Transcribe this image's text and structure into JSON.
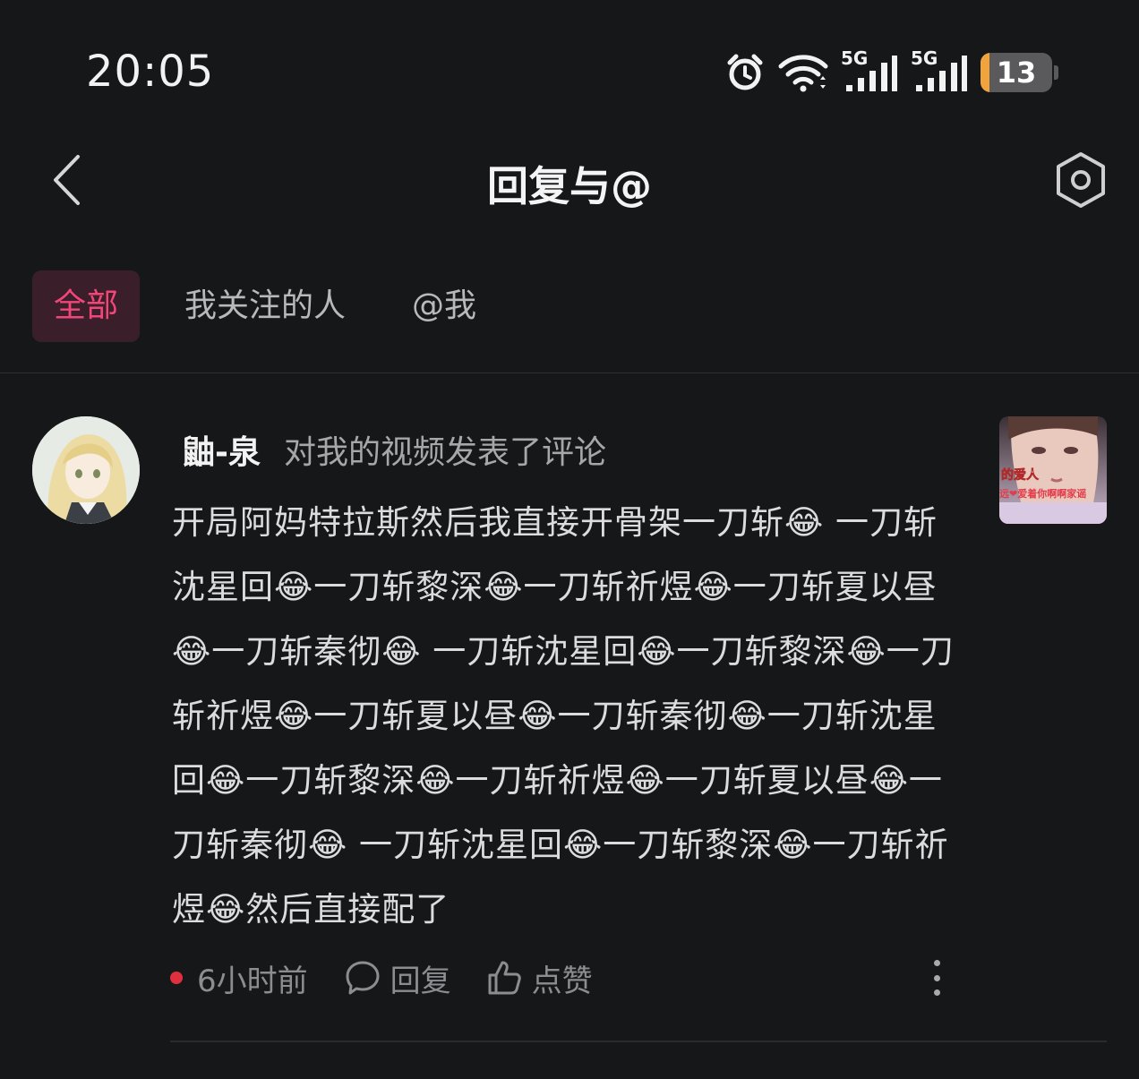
{
  "status_bar": {
    "time": "20:05",
    "network_1": "5G",
    "network_2": "5G",
    "battery_level": "13",
    "battery_percent": 13,
    "icons": [
      "alarm-icon",
      "wifi-icon",
      "signal-icon",
      "signal-icon",
      "battery-icon"
    ]
  },
  "header": {
    "title": "回复与@",
    "back_icon": "chevron-left-icon",
    "settings_icon": "settings-hexagon-icon"
  },
  "tabs": [
    {
      "label": "全部",
      "active": true
    },
    {
      "label": "我关注的人",
      "active": false
    },
    {
      "label": "@我",
      "active": false
    }
  ],
  "notification": {
    "username": "鼬-泉",
    "action": "对我的视频发表了评论",
    "comment": "开局阿妈特拉斯然后我直接开骨架一刀斩😂 一刀斩沈星回😂一刀斩黎深😂一刀斩祈煜😂一刀斩夏以昼😂一刀斩秦彻😂 一刀斩沈星回😂一刀斩黎深😂一刀斩祈煜😂一刀斩夏以昼😂一刀斩秦彻😂一刀斩沈星回😂一刀斩黎深😂一刀斩祈煜😂一刀斩夏以昼😂一刀斩秦彻😂 一刀斩沈星回😂一刀斩黎深😂一刀斩祈煜😂然后直接配了",
    "thumbnail_text_1": "的爱人",
    "thumbnail_text_2": "远❤爱着你啊啊家谣",
    "time": "6小时前",
    "reply_label": "回复",
    "like_label": "点赞",
    "unread": true
  },
  "colors": {
    "background": "#161719",
    "accent": "#f2467a",
    "unread_dot": "#e0303f",
    "battery": "#f0a43b"
  }
}
